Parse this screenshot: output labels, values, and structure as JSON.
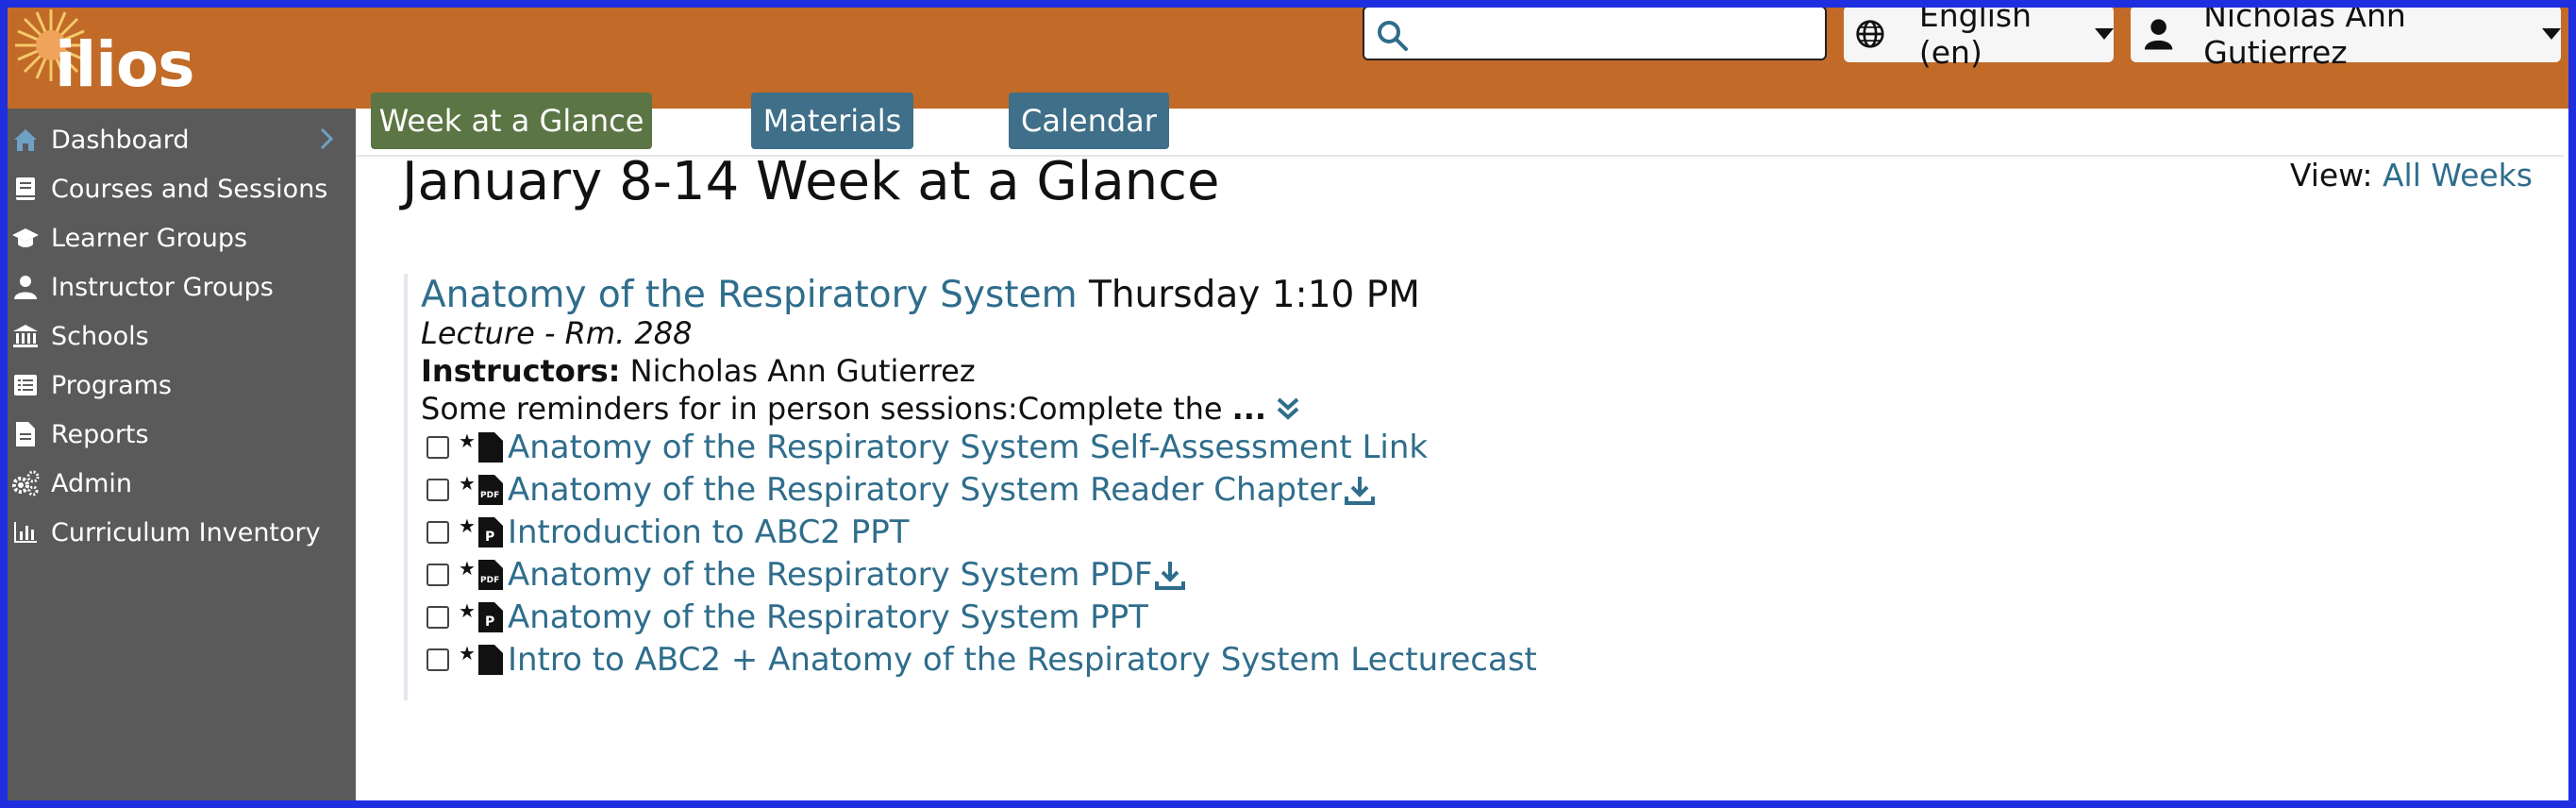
{
  "app": {
    "logo_text": "ilios",
    "brand_color": "#c26a28",
    "sidebar_color": "#5a5a5a",
    "link_color": "#2f6d8c"
  },
  "header": {
    "search": {
      "placeholder": "",
      "value": "",
      "icon": "search-icon"
    },
    "language": {
      "label": "English (en)",
      "icon": "globe-icon"
    },
    "user": {
      "label": "Nicholas Ann Gutierrez",
      "icon": "user-icon"
    }
  },
  "sidebar": {
    "items": [
      {
        "label": "Dashboard",
        "icon": "home-icon",
        "active": true
      },
      {
        "label": "Courses and Sessions",
        "icon": "book-icon"
      },
      {
        "label": "Learner Groups",
        "icon": "graduation-cap-icon"
      },
      {
        "label": "Instructor Groups",
        "icon": "instructor-icon"
      },
      {
        "label": "Schools",
        "icon": "university-icon"
      },
      {
        "label": "Programs",
        "icon": "list-icon"
      },
      {
        "label": "Reports",
        "icon": "file-icon"
      },
      {
        "label": "Admin",
        "icon": "cogs-icon"
      },
      {
        "label": "Curriculum Inventory",
        "icon": "chart-icon"
      }
    ]
  },
  "tabs": [
    {
      "label": "Week at a Glance",
      "color": "#5b7544",
      "active": true
    },
    {
      "label": "Materials",
      "color": "#3f6f89"
    },
    {
      "label": "Calendar",
      "color": "#3f6f89"
    }
  ],
  "main": {
    "title": "January 8-14 Week at a Glance",
    "view_label": "View:",
    "view_link": "All Weeks"
  },
  "event": {
    "name": "Anatomy of the Respiratory System",
    "time": "Thursday 1:10 PM",
    "type": "Lecture - Rm. 288",
    "instructors_label": "Instructors:",
    "instructors": "Nicholas Ann Gutierrez",
    "description": "Some reminders for in person sessions:Complete the",
    "ellipsis": "...",
    "materials": [
      {
        "label": "Anatomy of the Respiratory System Self-Assessment Link",
        "icon": "file-icon",
        "download": false
      },
      {
        "label": "Anatomy of the Respiratory System Reader Chapter",
        "icon": "pdf-icon",
        "download": true
      },
      {
        "label": "Introduction to ABC2 PPT",
        "icon": "ppt-icon",
        "download": false
      },
      {
        "label": "Anatomy of the Respiratory System PDF",
        "icon": "pdf-icon",
        "download": true
      },
      {
        "label": "Anatomy of the Respiratory System PPT",
        "icon": "ppt-icon",
        "download": false
      },
      {
        "label": "Intro to ABC2 + Anatomy of the Respiratory System Lecturecast",
        "icon": "file-icon",
        "download": false
      }
    ]
  }
}
